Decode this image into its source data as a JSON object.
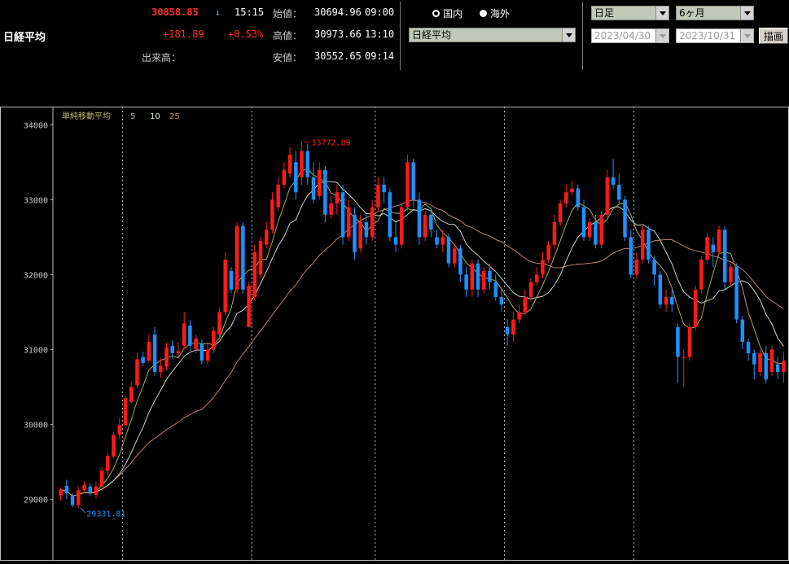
{
  "header": {
    "index_name": "日経平均",
    "price": "30858.85",
    "arrow": "↓",
    "time": "15:15",
    "change": "+181.89",
    "change_pct": "+0.53%",
    "volume_label": "出来高：",
    "open_label": "始値：",
    "open_value": "30694.96",
    "open_time": "09:00",
    "high_label": "高値：",
    "high_value": "30973.66",
    "high_time": "13:10",
    "low_label": "安値：",
    "low_value": "30552.65",
    "low_time": "09:14"
  },
  "market": {
    "options": [
      "国内",
      "海外"
    ],
    "selected": "国内",
    "index_select": "日経平均"
  },
  "period": {
    "interval": "日足",
    "range": "6ヶ月",
    "start_date": "2023/04/30",
    "end_date": "2023/10/31",
    "draw_button": "描画"
  },
  "colors": {
    "up": "#ff1a1a",
    "down": "#1e90ff",
    "ma5": "#b8b860",
    "ma10": "#d8e8d8",
    "ma25": "#c89078",
    "grid": "#bbbbbb"
  },
  "chart_data": {
    "type": "candlestick",
    "legend": {
      "label": "単純移動平均",
      "periods": [
        "5",
        "10",
        "25"
      ]
    },
    "ylim": [
      28200,
      34200
    ],
    "yticks": [
      "34000",
      "33000",
      "32000",
      "31000",
      "30000",
      "29000"
    ],
    "annotations": {
      "high": "33772.89",
      "low": "29331.81"
    },
    "month_breaks": [
      11,
      33,
      54,
      76,
      98
    ],
    "candles": [
      [
        29050,
        29130,
        28980,
        29160
      ],
      [
        29180,
        29080,
        29000,
        29260
      ],
      [
        29040,
        28920,
        28890,
        29080
      ],
      [
        28920,
        29120,
        28880,
        29170
      ],
      [
        29120,
        29190,
        29080,
        29240
      ],
      [
        29170,
        29080,
        29040,
        29210
      ],
      [
        29060,
        29170,
        29010,
        29230
      ],
      [
        29170,
        29380,
        29110,
        29430
      ],
      [
        29380,
        29580,
        29320,
        29620
      ],
      [
        29570,
        29860,
        29540,
        29900
      ],
      [
        29860,
        29990,
        29800,
        30080
      ],
      [
        29990,
        30350,
        29950,
        30390
      ],
      [
        30300,
        30500,
        30280,
        30570
      ],
      [
        30520,
        30870,
        30480,
        30960
      ],
      [
        30900,
        30820,
        30780,
        30970
      ],
      [
        30850,
        31100,
        30820,
        31200
      ],
      [
        31200,
        30700,
        30650,
        31300
      ],
      [
        30700,
        30780,
        30620,
        30880
      ],
      [
        30770,
        31030,
        30720,
        31090
      ],
      [
        31050,
        30950,
        30880,
        31120
      ],
      [
        30950,
        30980,
        30900,
        31100
      ],
      [
        31050,
        31350,
        31000,
        31500
      ],
      [
        31320,
        31050,
        30980,
        31390
      ],
      [
        31000,
        31150,
        30950,
        31200
      ],
      [
        31080,
        30850,
        30800,
        31130
      ],
      [
        30850,
        31000,
        30800,
        31100
      ],
      [
        31000,
        31250,
        30950,
        31300
      ],
      [
        31200,
        31500,
        31150,
        31560
      ],
      [
        31500,
        32200,
        31450,
        32300
      ],
      [
        32050,
        31800,
        31750,
        32100
      ],
      [
        31800,
        32650,
        31750,
        32700
      ],
      [
        32650,
        31800,
        31750,
        32700
      ],
      [
        31300,
        31850,
        31300,
        31900
      ],
      [
        31700,
        32300,
        31650,
        32400
      ],
      [
        32000,
        32450,
        31950,
        32500
      ],
      [
        32400,
        32600,
        32350,
        32700
      ],
      [
        32600,
        33000,
        32550,
        33100
      ],
      [
        32900,
        33200,
        32850,
        33300
      ],
      [
        33200,
        33400,
        33150,
        33500
      ],
      [
        33350,
        33600,
        33300,
        33700
      ],
      [
        33500,
        33100,
        33000,
        33650
      ],
      [
        33300,
        33650,
        33200,
        33773
      ],
      [
        33650,
        33300,
        33200,
        33750
      ],
      [
        33300,
        33000,
        32950,
        33500
      ],
      [
        33050,
        33400,
        33000,
        33500
      ],
      [
        33400,
        32800,
        32700,
        33450
      ],
      [
        32800,
        32950,
        32750,
        33050
      ],
      [
        32950,
        33100,
        32800,
        33200
      ],
      [
        33100,
        32500,
        32400,
        33200
      ],
      [
        32500,
        32900,
        32450,
        33000
      ],
      [
        32800,
        32300,
        32200,
        32900
      ],
      [
        32350,
        32700,
        32300,
        32800
      ],
      [
        32700,
        32500,
        32400,
        32800
      ],
      [
        32500,
        32900,
        32450,
        33000
      ],
      [
        32900,
        33200,
        32850,
        33300
      ],
      [
        33200,
        33100,
        32950,
        33300
      ],
      [
        33100,
        32500,
        32450,
        33150
      ],
      [
        32500,
        32400,
        32300,
        32700
      ],
      [
        32400,
        32900,
        32350,
        32950
      ],
      [
        32900,
        33500,
        32850,
        33600
      ],
      [
        33500,
        33000,
        32900,
        33550
      ],
      [
        33000,
        32500,
        32400,
        33100
      ],
      [
        32500,
        32800,
        32450,
        32850
      ],
      [
        32800,
        32600,
        32500,
        32900
      ],
      [
        32500,
        32400,
        32350,
        32600
      ],
      [
        32400,
        32500,
        32300,
        32600
      ],
      [
        32500,
        32150,
        32100,
        32550
      ],
      [
        32150,
        32350,
        32100,
        32400
      ],
      [
        32350,
        32000,
        31900,
        32400
      ],
      [
        32000,
        31800,
        31700,
        32100
      ],
      [
        31800,
        32150,
        31700,
        32200
      ],
      [
        32150,
        31800,
        31700,
        32200
      ],
      [
        31800,
        32050,
        31750,
        32100
      ],
      [
        32050,
        31900,
        31800,
        32150
      ],
      [
        31900,
        31700,
        31650,
        32000
      ],
      [
        31700,
        31600,
        31500,
        31800
      ],
      [
        31300,
        31200,
        31050,
        31400
      ],
      [
        31200,
        31400,
        31100,
        31500
      ],
      [
        31400,
        31500,
        31350,
        31600
      ],
      [
        31500,
        31700,
        31450,
        31800
      ],
      [
        31700,
        31900,
        31650,
        31950
      ],
      [
        31900,
        32000,
        31850,
        32100
      ],
      [
        32000,
        32200,
        31950,
        32300
      ],
      [
        32200,
        32400,
        32150,
        32450
      ],
      [
        32400,
        32700,
        32350,
        32800
      ],
      [
        32700,
        32950,
        32650,
        33000
      ],
      [
        32950,
        33100,
        32900,
        33200
      ],
      [
        33100,
        33150,
        33050,
        33250
      ],
      [
        33150,
        32900,
        32850,
        33200
      ],
      [
        32900,
        32500,
        32450,
        33000
      ],
      [
        32500,
        32700,
        32450,
        32750
      ],
      [
        32700,
        32400,
        32350,
        32800
      ],
      [
        32400,
        32800,
        32350,
        32850
      ],
      [
        32800,
        33300,
        32750,
        33400
      ],
      [
        33300,
        33200,
        33150,
        33550
      ],
      [
        33200,
        33000,
        32950,
        33350
      ],
      [
        33000,
        32500,
        32450,
        33050
      ],
      [
        32500,
        32000,
        31950,
        32600
      ],
      [
        32000,
        32200,
        31950,
        32300
      ],
      [
        32200,
        32600,
        32150,
        32650
      ],
      [
        32600,
        32200,
        32150,
        32650
      ],
      [
        32200,
        32000,
        31850,
        32250
      ],
      [
        32000,
        31600,
        31550,
        32050
      ],
      [
        31600,
        31700,
        31500,
        31800
      ],
      [
        31700,
        31600,
        31500,
        31800
      ],
      [
        31300,
        30900,
        30550,
        31350
      ],
      [
        30900,
        30900,
        30500,
        31000
      ],
      [
        30900,
        31300,
        30850,
        31350
      ],
      [
        31300,
        31800,
        31250,
        31850
      ],
      [
        31800,
        32200,
        31750,
        32250
      ],
      [
        32200,
        32500,
        32150,
        32550
      ],
      [
        32400,
        32300,
        32100,
        32500
      ],
      [
        32300,
        32600,
        32250,
        32650
      ],
      [
        32600,
        31900,
        31800,
        32650
      ],
      [
        31900,
        32100,
        31850,
        32150
      ],
      [
        32100,
        31400,
        31350,
        32150
      ],
      [
        31400,
        31100,
        31000,
        31450
      ],
      [
        31100,
        30950,
        30850,
        31150
      ],
      [
        30950,
        30800,
        30600,
        31000
      ],
      [
        30700,
        30950,
        30650,
        31000
      ],
      [
        30950,
        30600,
        30550,
        31050
      ],
      [
        30700,
        31000,
        30650,
        31050
      ],
      [
        30800,
        30700,
        30600,
        30900
      ],
      [
        30700,
        30850,
        30550,
        30970
      ]
    ]
  }
}
